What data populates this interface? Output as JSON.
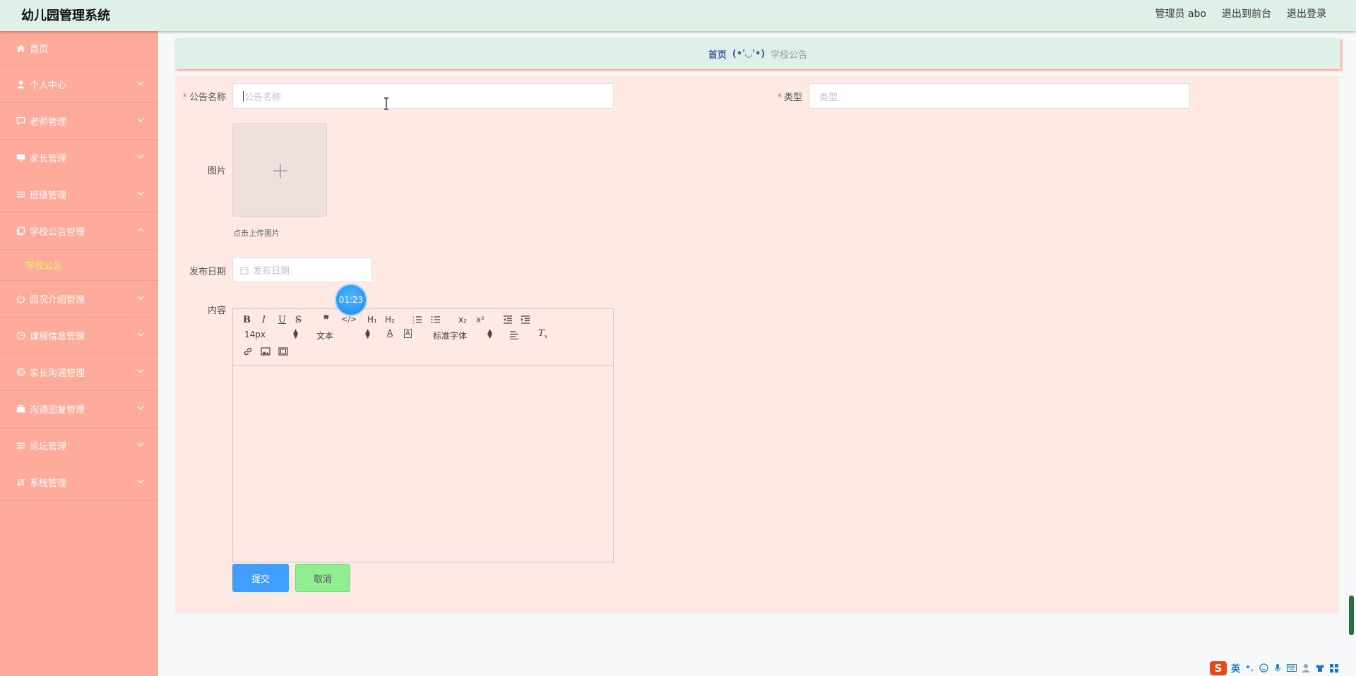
{
  "header": {
    "title": "幼儿园管理系统",
    "user_label": "管理员 abo",
    "front_label": "退出到前台",
    "logout_label": "退出登录"
  },
  "sidebar": {
    "items": [
      {
        "label": "首页",
        "icon": "home-icon"
      },
      {
        "label": "个人中心",
        "icon": "user-icon"
      },
      {
        "label": "老师管理",
        "icon": "chat-icon"
      },
      {
        "label": "家长管理",
        "icon": "monitor-icon"
      },
      {
        "label": "班级管理",
        "icon": "list-icon"
      },
      {
        "label": "学校公告管理",
        "icon": "copy-icon",
        "expanded": true
      },
      {
        "label": "园况介绍管理",
        "icon": "power-icon"
      },
      {
        "label": "课程信息管理",
        "icon": "clock-icon"
      },
      {
        "label": "家长沟通管理",
        "icon": "target-icon"
      },
      {
        "label": "沟通回复管理",
        "icon": "briefcase-icon"
      },
      {
        "label": "论坛管理",
        "icon": "list-icon"
      },
      {
        "label": "系统管理",
        "icon": "bell-off-icon"
      }
    ],
    "sub_active": "学校公告"
  },
  "breadcrumb": {
    "home": "首页",
    "separator": "(•'◡'•)",
    "current": "学校公告"
  },
  "form": {
    "name_label": "公告名称",
    "name_placeholder": "公告名称",
    "type_label": "类型",
    "type_placeholder": "类型",
    "image_label": "图片",
    "upload_hint": "点击上传图片",
    "date_label": "发布日期",
    "date_placeholder": "发布日期",
    "content_label": "内容",
    "submit": "提交",
    "cancel": "取消"
  },
  "editor": {
    "font_size": "14px",
    "text_style": "文本",
    "font_family": "标准字体",
    "h1": "H₁",
    "h2": "H₂"
  },
  "timer": "01:23",
  "tray": {
    "ime_logo": "S",
    "ime_lang": "英"
  },
  "colors": {
    "header_bg": "#dff0e8",
    "sidebar_bg": "#ffab9b",
    "panel_bg": "#ffe9e4",
    "submit": "#409eff",
    "cancel": "#90ee90",
    "active_sub": "#f7f55a"
  }
}
